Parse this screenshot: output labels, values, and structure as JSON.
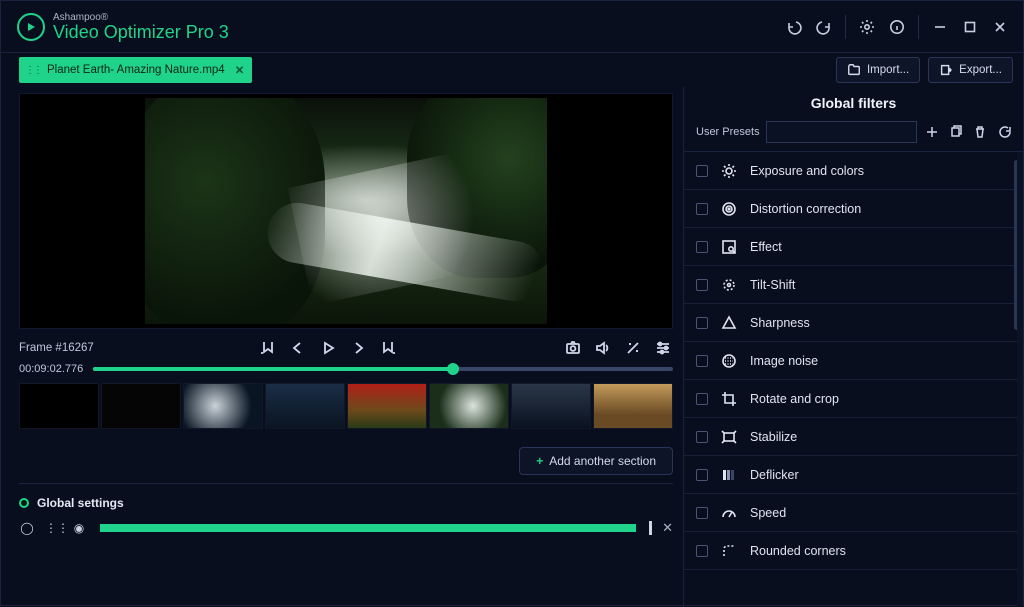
{
  "brand": {
    "top": "Ashampoo®",
    "main": "Video Optimizer Pro 3"
  },
  "file_tab": {
    "name": "Planet Earth- Amazing Nature.mp4"
  },
  "io": {
    "import": "Import...",
    "export": "Export..."
  },
  "preview": {
    "frame_label": "Frame #16267",
    "timecode": "00:09:02.776"
  },
  "add_section": "Add another section",
  "global_settings": {
    "title": "Global settings"
  },
  "right": {
    "title": "Global filters",
    "presets_label": "User Presets",
    "filters": [
      "Exposure and colors",
      "Distortion correction",
      "Effect",
      "Tilt-Shift",
      "Sharpness",
      "Image noise",
      "Rotate and crop",
      "Stabilize",
      "Deflicker",
      "Speed",
      "Rounded corners"
    ]
  }
}
